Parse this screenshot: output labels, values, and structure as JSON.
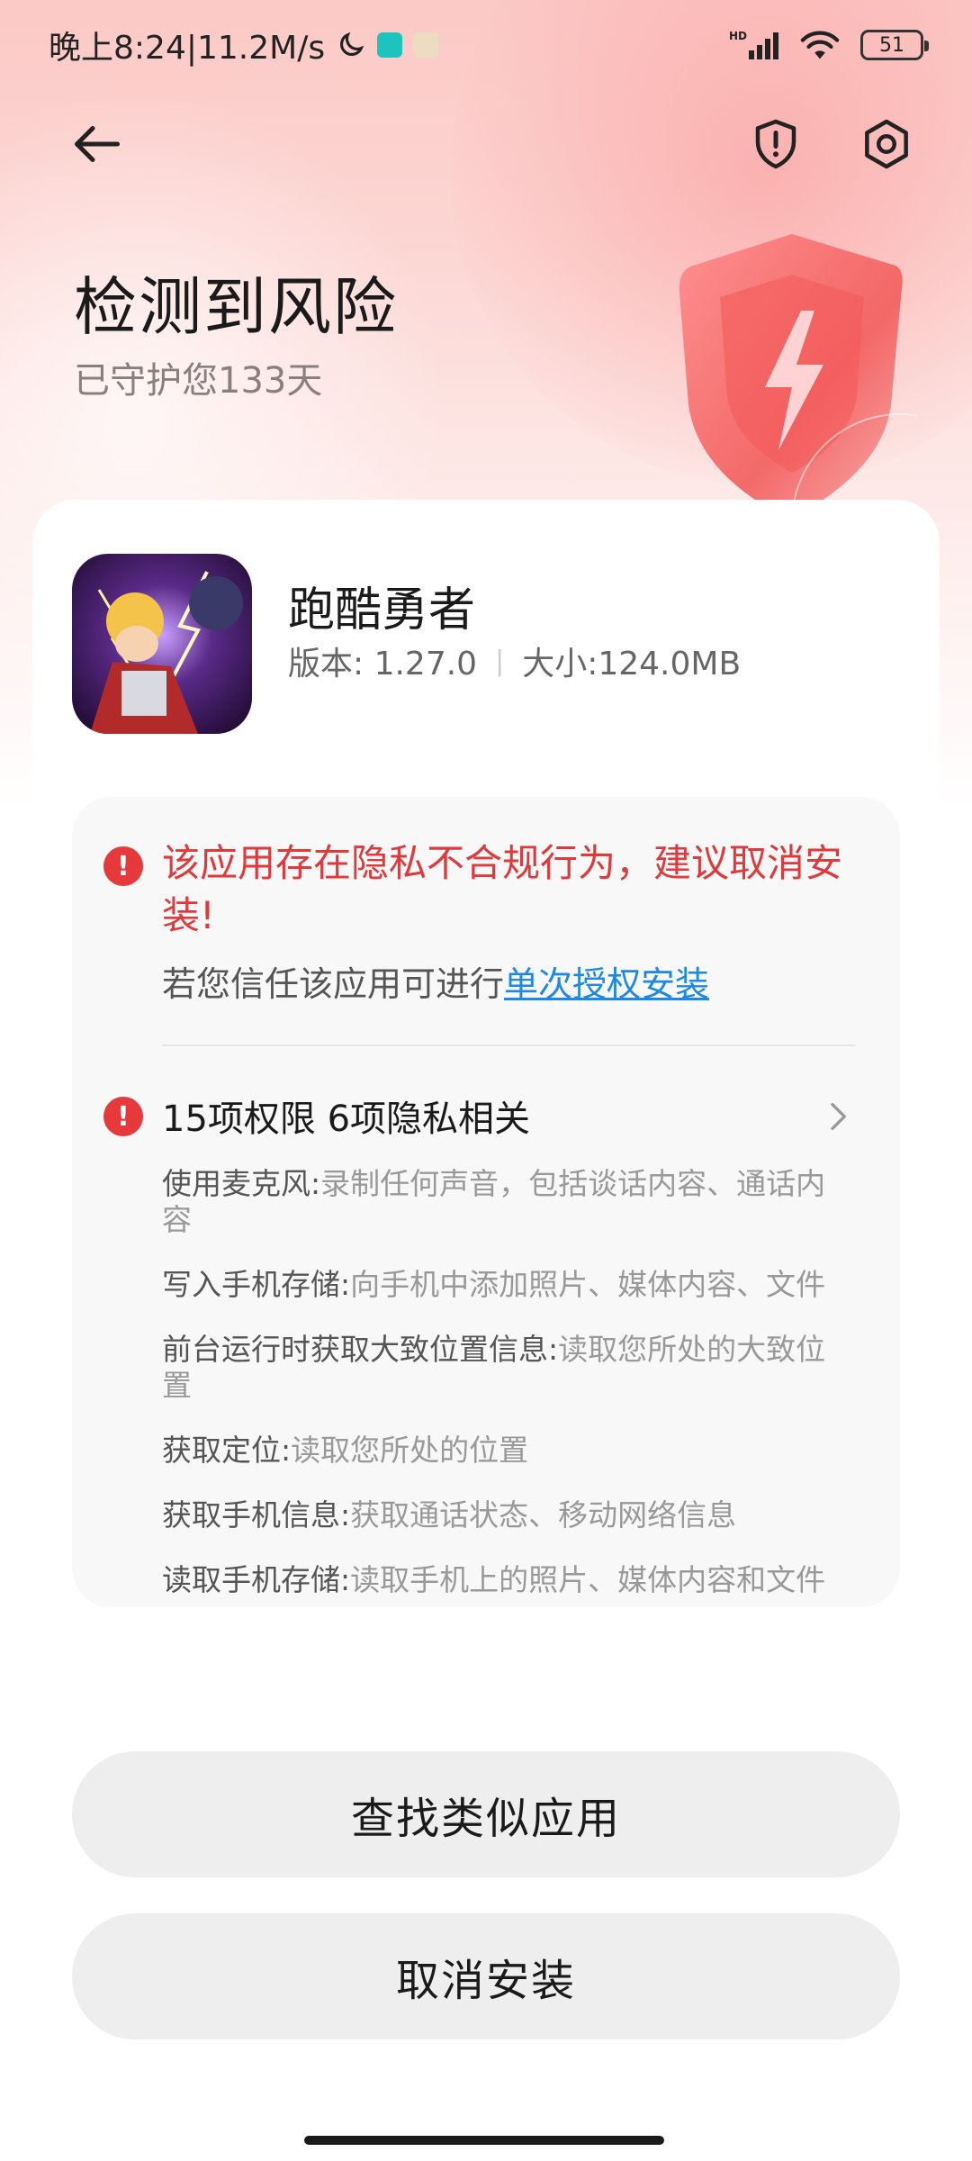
{
  "status_bar": {
    "time_speed": "晚上8:24|11.2M/s",
    "battery": "51",
    "icons": [
      "moon-icon",
      "taptap-icon",
      "sim-icon",
      "signal-icon",
      "wifi-icon",
      "battery-icon"
    ]
  },
  "header": {
    "back_icon": "arrow-left-icon",
    "report_icon": "shield-alert-icon",
    "settings_icon": "gear-icon",
    "title": "检测到风险",
    "subtitle": "已守护您133天"
  },
  "app": {
    "name": "跑酷勇者",
    "version": "版本: 1.27.0",
    "size": "大小:124.0MB"
  },
  "warning": {
    "message": "该应用存在隐私不合规行为，建议取消安装!",
    "trust_prefix": "若您信任该应用可进行",
    "trust_link": "单次授权安装"
  },
  "permissions": {
    "summary": "15项权限 6项隐私相关",
    "items": [
      {
        "name": "使用麦克风:",
        "desc": "录制任何声音，包括谈话内容、通话内容"
      },
      {
        "name": "写入手机存储:",
        "desc": "向手机中添加照片、媒体内容、文件"
      },
      {
        "name": "前台运行时获取大致位置信息:",
        "desc": "读取您所处的大致位置"
      },
      {
        "name": "获取定位:",
        "desc": "读取您所处的位置"
      },
      {
        "name": "获取手机信息:",
        "desc": "获取通话状态、移动网络信息"
      },
      {
        "name": "读取手机存储:",
        "desc": "读取手机上的照片、媒体内容和文件"
      }
    ]
  },
  "buttons": {
    "find_similar": "查找类似应用",
    "cancel_install": "取消安装"
  },
  "colors": {
    "danger": "#e5393b",
    "link": "#1e88e5",
    "button_bg": "#eeeeee"
  }
}
